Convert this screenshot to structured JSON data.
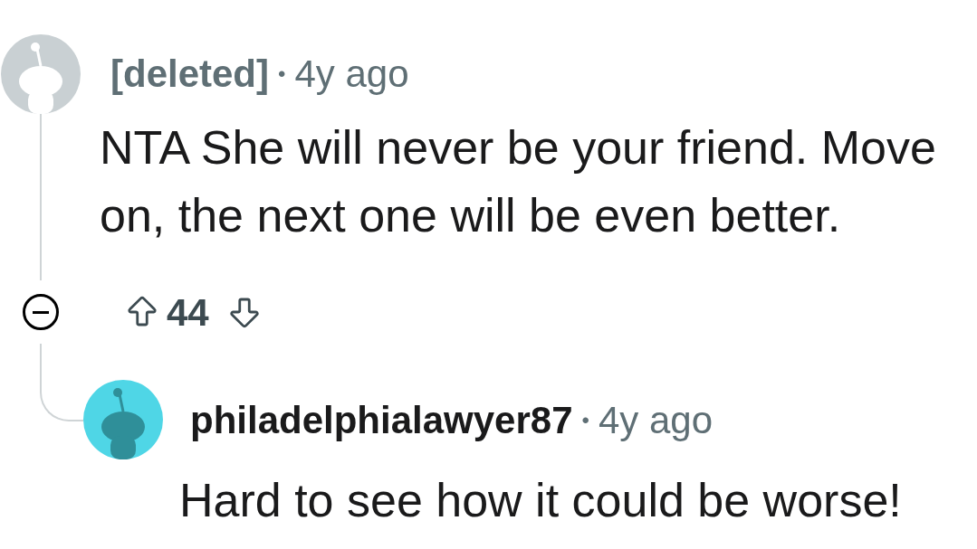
{
  "comment": {
    "author": "[deleted]",
    "author_deleted": true,
    "separator": "•",
    "time": "4y ago",
    "body": "NTA She will never be your friend. Move on, the next one will be even better.",
    "expanded": true,
    "votes": "44",
    "replies": [
      {
        "author": "philadelphialawyer87",
        "author_deleted": false,
        "separator": "•",
        "time": "4y ago",
        "body": "Hard to see how it could be worse!"
      }
    ]
  }
}
